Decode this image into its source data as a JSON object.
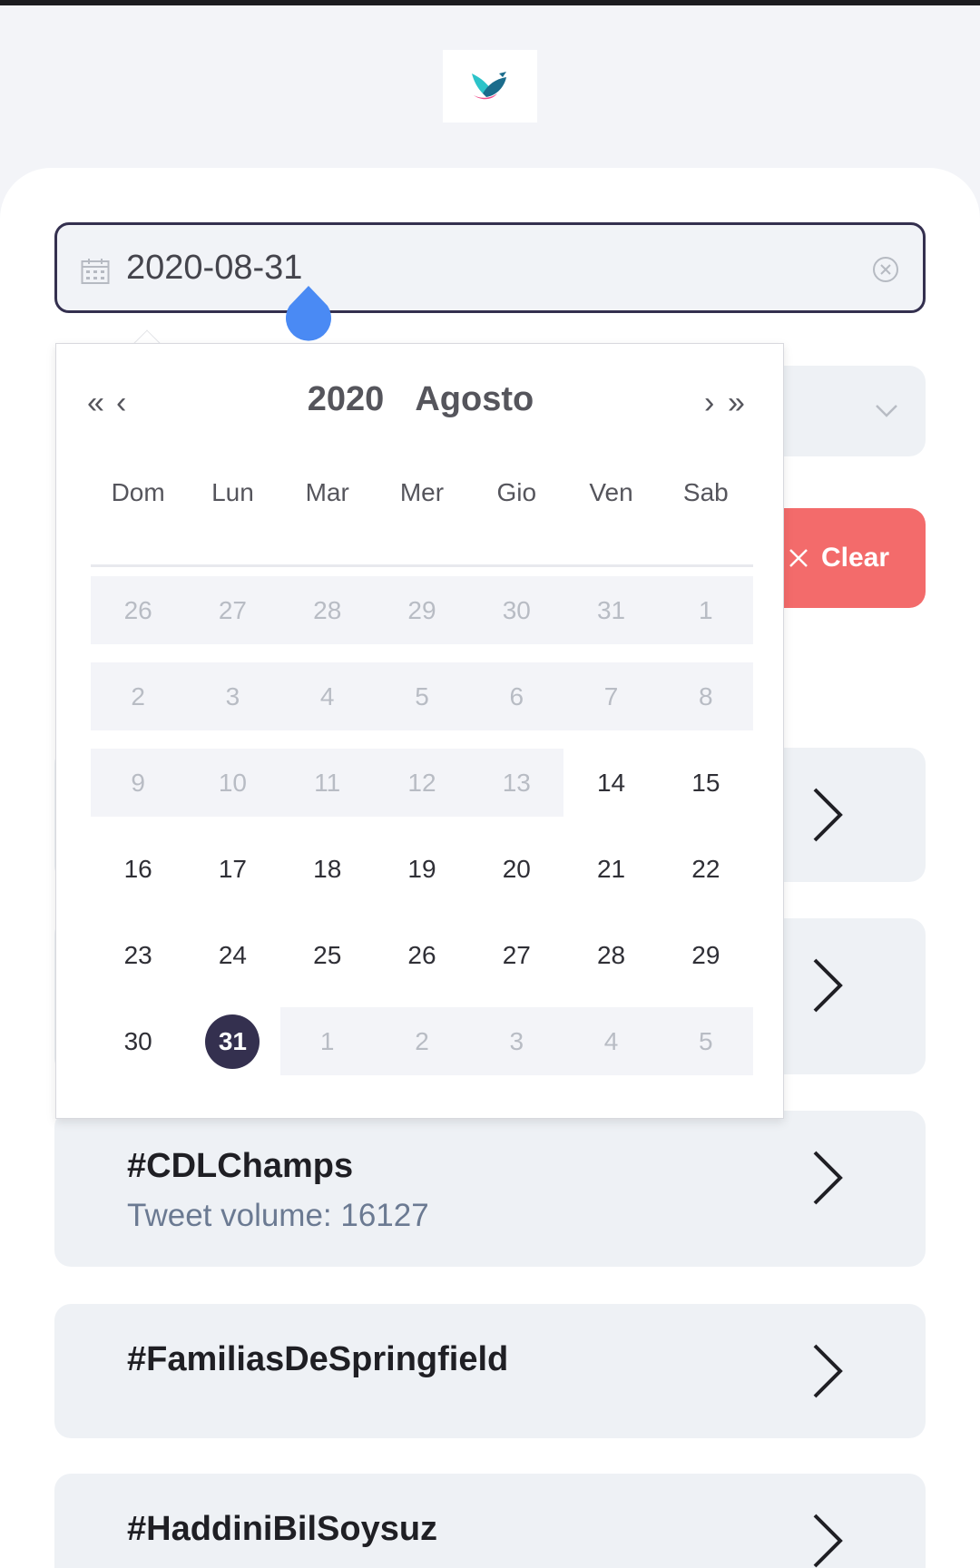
{
  "date_input": {
    "value": "2020-08-31"
  },
  "calendar": {
    "year": "2020",
    "month": "Agosto",
    "weekdays": [
      "Dom",
      "Lun",
      "Mar",
      "Mer",
      "Gio",
      "Ven",
      "Sab"
    ],
    "weeks": [
      [
        "26",
        "27",
        "28",
        "29",
        "30",
        "31",
        "1"
      ],
      [
        "2",
        "3",
        "4",
        "5",
        "6",
        "7",
        "8"
      ],
      [
        "9",
        "10",
        "11",
        "12",
        "13",
        "14",
        "15"
      ],
      [
        "16",
        "17",
        "18",
        "19",
        "20",
        "21",
        "22"
      ],
      [
        "23",
        "24",
        "25",
        "26",
        "27",
        "28",
        "29"
      ],
      [
        "30",
        "31",
        "1",
        "2",
        "3",
        "4",
        "5"
      ]
    ],
    "selected": "31"
  },
  "clear_button": {
    "label": "Clear"
  },
  "trends": [
    {
      "title": "#CDLChamps",
      "subtitle": "Tweet volume: 16127"
    },
    {
      "title": "#FamiliasDeSpringfield",
      "subtitle": ""
    },
    {
      "title": "#HaddiniBilSoysuz",
      "subtitle": ""
    }
  ],
  "colors": {
    "accent": "#34304f",
    "danger": "#f36b6b",
    "handle": "#4a8af4"
  }
}
